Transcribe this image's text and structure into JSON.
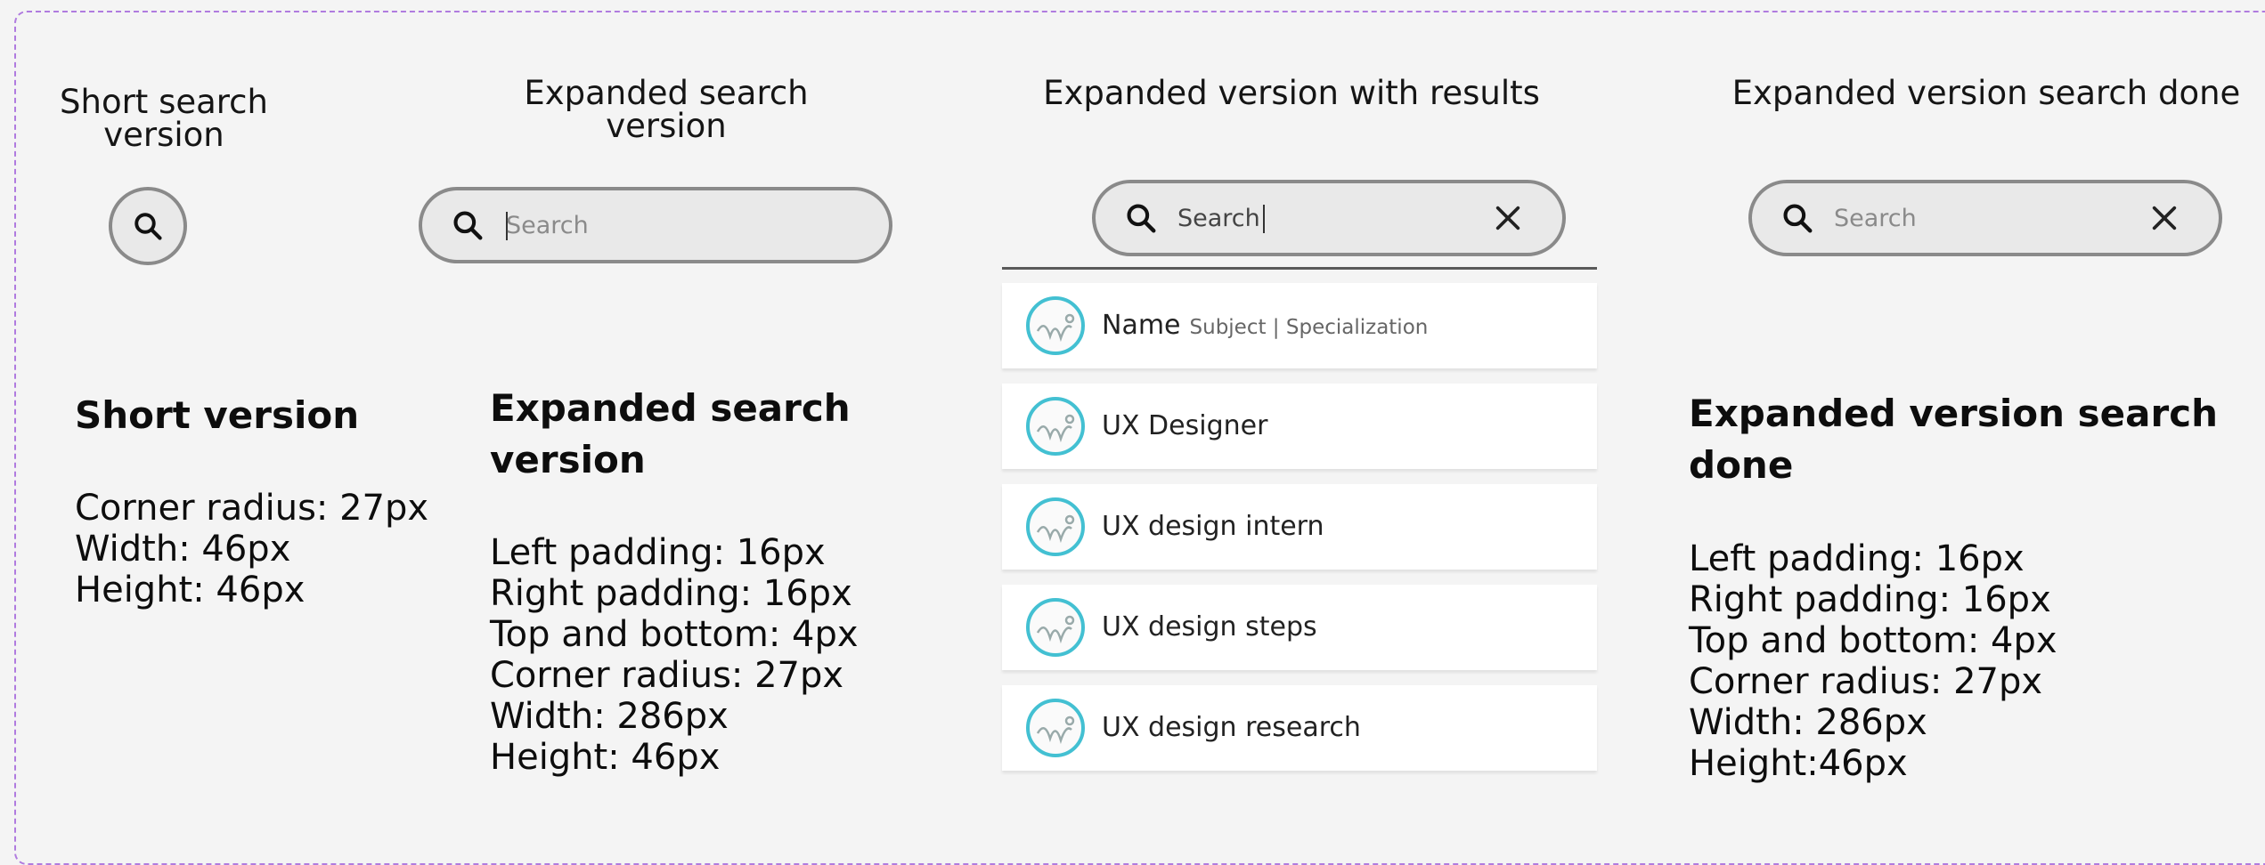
{
  "columns": {
    "short": {
      "heading_line1": "Short search",
      "heading_line2": "version"
    },
    "expanded": {
      "heading_line1": "Expanded search",
      "heading_line2": "version",
      "placeholder": "Search"
    },
    "results": {
      "heading": "Expanded version with results",
      "input_value": "Search"
    },
    "done": {
      "heading": "Expanded version search done",
      "placeholder": "Search"
    }
  },
  "results_list": [
    {
      "name": "Name",
      "subtitle": "Subject | Specialization"
    },
    {
      "name": "UX Designer",
      "subtitle": ""
    },
    {
      "name": "UX design intern",
      "subtitle": ""
    },
    {
      "name": "UX design steps",
      "subtitle": ""
    },
    {
      "name": "UX design research",
      "subtitle": ""
    }
  ],
  "notes": {
    "short": {
      "title": "Short version",
      "lines": [
        "Corner radius: 27px",
        "Width: 46px",
        "Height: 46px"
      ]
    },
    "expanded": {
      "title_line1": "Expanded search",
      "title_line2": "version",
      "lines": [
        "Left padding: 16px",
        "Right padding: 16px",
        "Top and bottom: 4px",
        "Corner radius: 27px",
        "Width: 286px",
        "Height: 46px"
      ]
    },
    "done": {
      "title_line1": "Expanded version search",
      "title_line2": "done",
      "lines": [
        "Left padding: 16px",
        "Right padding: 16px",
        "Top and bottom: 4px",
        "Corner radius: 27px",
        "Width: 286px",
        "Height:46px"
      ]
    }
  },
  "icons": {
    "search": "search-icon",
    "clear": "close-icon",
    "avatar": "avatar-icon"
  },
  "colors": {
    "frame_border": "#b07bdf",
    "bar_border": "#8a8a8a",
    "bar_fill": "#e9e9e9",
    "avatar_ring": "#43c0d2"
  }
}
